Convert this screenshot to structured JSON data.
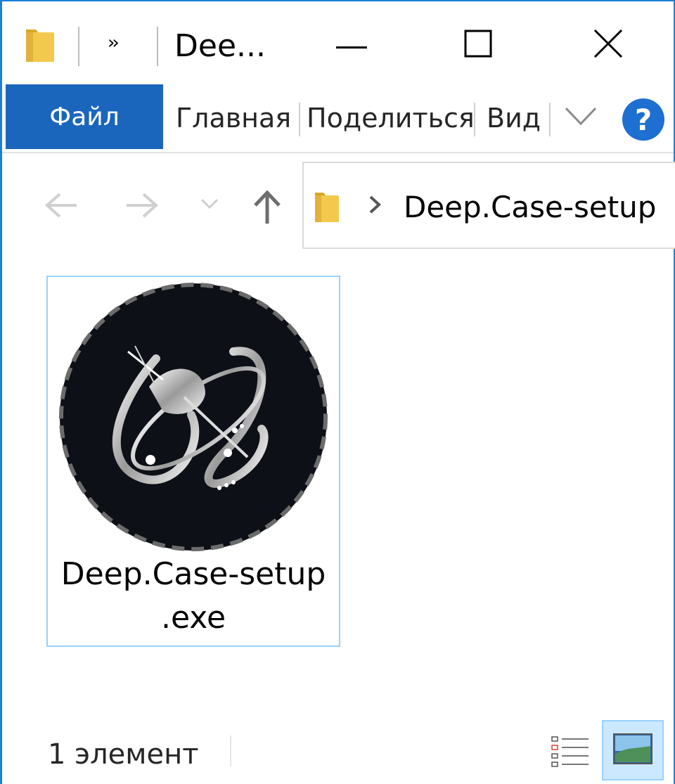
{
  "window": {
    "title": "Dee...",
    "more_glyph": "››"
  },
  "ribbon": {
    "tabs": [
      {
        "label": "Файл"
      },
      {
        "label": "Главная"
      },
      {
        "label": "Поделиться"
      },
      {
        "label": "Вид"
      }
    ],
    "help_label": "?"
  },
  "nav": {
    "address_path": "Deep.Case-setup"
  },
  "files": [
    {
      "name_line1": "Deep.Case-setup",
      "name_line2": ".exe"
    }
  ],
  "status": {
    "item_count": "1 элемент"
  },
  "icons": [
    "folder-icon",
    "minimize-icon",
    "maximize-icon",
    "close-icon",
    "chevron-down-icon",
    "help-icon",
    "back-arrow-icon",
    "forward-arrow-icon",
    "recent-dropdown-icon",
    "up-arrow-icon",
    "breadcrumb-chevron-icon",
    "details-view-icon",
    "large-icons-view-icon"
  ],
  "colors": {
    "accent": "#1a66bd",
    "selection_border": "#99d1ff",
    "selection_fill": "#cce8ff",
    "window_border": "#1b7fd4"
  }
}
